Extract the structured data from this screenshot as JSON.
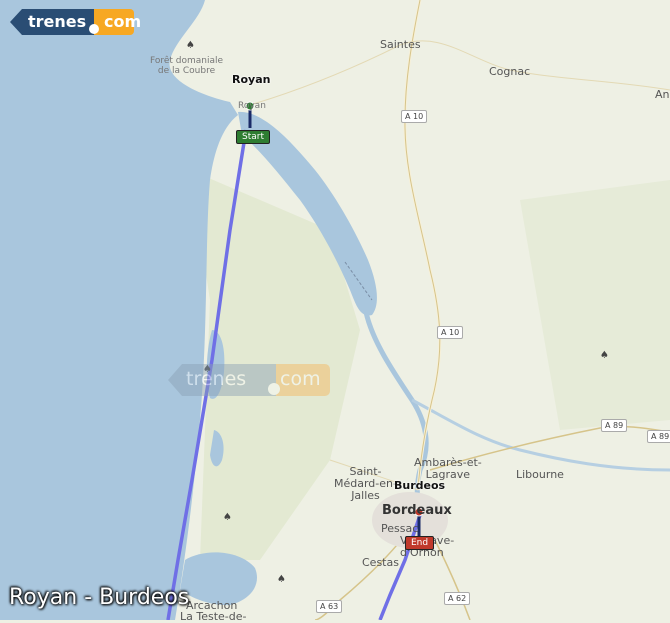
{
  "logo": {
    "brand": "trenes",
    "tld": "com"
  },
  "route": {
    "title": "Royan - Burdeos",
    "origin": {
      "name": "Royan",
      "badge": "Start",
      "badge_color": "#2e7d32"
    },
    "destination": {
      "name": "Burdeos",
      "badge": "End",
      "badge_color": "#c0392b"
    },
    "line_color": "#6f6fe6"
  },
  "map": {
    "sea_color": "#a9c6dd",
    "land_color": "#eef0e4",
    "places": [
      {
        "id": "saintes",
        "label": "Saintes"
      },
      {
        "id": "cognac",
        "label": "Cognac"
      },
      {
        "id": "royan-town",
        "label": "Royan"
      },
      {
        "id": "foret",
        "label": "Forêt domaniale\nde la Coubre"
      },
      {
        "id": "libourne",
        "label": "Libourne"
      },
      {
        "id": "ambares",
        "label": "Ambarès-et-\nLagrave"
      },
      {
        "id": "saint-medard",
        "label": "Saint-\nMédard-en-\nJalles"
      },
      {
        "id": "bordeaux",
        "label": "Bordeaux"
      },
      {
        "id": "pessac",
        "label": "Pessac"
      },
      {
        "id": "villenave",
        "label": "Villenave-\nd'Ornon"
      },
      {
        "id": "cestas",
        "label": "Cestas"
      },
      {
        "id": "teste",
        "label": "La Teste-de-"
      },
      {
        "id": "pyla",
        "label": "Arcachon"
      },
      {
        "id": "an",
        "label": "An"
      }
    ],
    "roads": [
      {
        "id": "a10-north",
        "label": "A 10"
      },
      {
        "id": "a10-mid",
        "label": "A 10"
      },
      {
        "id": "a89",
        "label": "A 89"
      },
      {
        "id": "a89-east",
        "label": "A 89"
      },
      {
        "id": "a63",
        "label": "A 63"
      },
      {
        "id": "a62",
        "label": "A 62"
      }
    ]
  }
}
